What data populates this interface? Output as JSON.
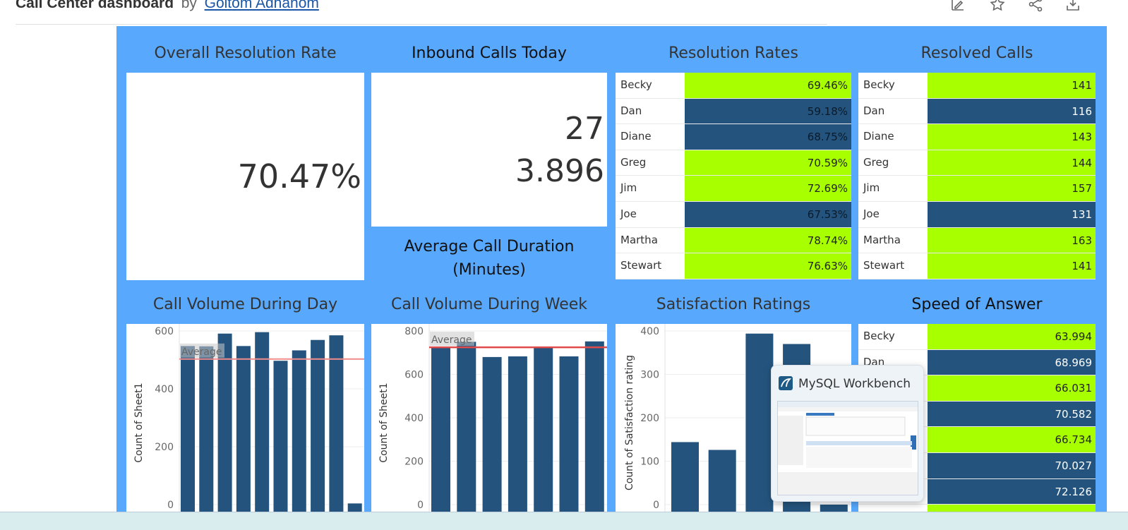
{
  "header": {
    "title": "Call Center dashboard",
    "by": "by",
    "author": "Goitom Adhanom",
    "tools": [
      "edit-icon",
      "star-icon",
      "share-icon",
      "download-icon"
    ]
  },
  "panels": {
    "overall_resolution": {
      "title": "Overall Resolution Rate",
      "value": "70.47%"
    },
    "inbound_calls": {
      "title": "Inbound Calls Today",
      "value": "27",
      "avg_value": "3.896"
    },
    "avg_duration": {
      "title_line1": "Average Call Duration",
      "title_line2": "(Minutes)"
    },
    "resolution_rates": {
      "title": "Resolution Rates",
      "rows": [
        {
          "name": "Becky",
          "value": "69.46%",
          "color": "green"
        },
        {
          "name": "Dan",
          "value": "59.18%",
          "color": "blue"
        },
        {
          "name": "Diane",
          "value": "68.75%",
          "color": "blue"
        },
        {
          "name": "Greg",
          "value": "70.59%",
          "color": "green"
        },
        {
          "name": "Jim",
          "value": "72.69%",
          "color": "green"
        },
        {
          "name": "Joe",
          "value": "67.53%",
          "color": "blue"
        },
        {
          "name": "Martha",
          "value": "78.74%",
          "color": "green"
        },
        {
          "name": "Stewart",
          "value": "76.63%",
          "color": "green"
        }
      ]
    },
    "resolved_calls": {
      "title": "Resolved Calls",
      "rows": [
        {
          "name": "Becky",
          "value": "141",
          "color": "green"
        },
        {
          "name": "Dan",
          "value": "116",
          "color": "blue"
        },
        {
          "name": "Diane",
          "value": "143",
          "color": "green"
        },
        {
          "name": "Greg",
          "value": "144",
          "color": "green"
        },
        {
          "name": "Jim",
          "value": "157",
          "color": "green"
        },
        {
          "name": "Joe",
          "value": "131",
          "color": "blue"
        },
        {
          "name": "Martha",
          "value": "163",
          "color": "green"
        },
        {
          "name": "Stewart",
          "value": "141",
          "color": "green"
        }
      ]
    },
    "speed_of_answer": {
      "title": "Speed of Answer",
      "rows": [
        {
          "name": "Becky",
          "value": "63.994",
          "color": "green"
        },
        {
          "name": "Dan",
          "value": "68.969",
          "color": "blue"
        },
        {
          "name": "",
          "value": "66.031",
          "color": "green"
        },
        {
          "name": "",
          "value": "70.582",
          "color": "blue"
        },
        {
          "name": "",
          "value": "66.734",
          "color": "green"
        },
        {
          "name": "",
          "value": "70.027",
          "color": "blue"
        },
        {
          "name": "",
          "value": "72.126",
          "color": "blue"
        },
        {
          "name": "",
          "value": "",
          "color": "green"
        }
      ]
    }
  },
  "colors": {
    "green": "#a8ff00",
    "blue": "#24547d",
    "background": "#58a9fd",
    "avg_line": "#e05a5a"
  },
  "popup": {
    "title": "MySQL Workbench"
  },
  "chart_data": [
    {
      "type": "bar",
      "title": "Call Volume During Day",
      "ylabel": "Count of Sheet1",
      "ylim": [
        0,
        600
      ],
      "yticks": [
        "0",
        "200",
        "400",
        "600"
      ],
      "average_label": "Average",
      "average": 503,
      "values": [
        548,
        547,
        591,
        548,
        596,
        497,
        533,
        569,
        585,
        4
      ]
    },
    {
      "type": "bar",
      "title": "Call Volume During Week",
      "ylabel": "Count of Sheet1",
      "ylim": [
        0,
        800
      ],
      "yticks": [
        "0",
        "200",
        "400",
        "600",
        "800"
      ],
      "average_label": "Average",
      "average": 725,
      "values": [
        727,
        750,
        680,
        683,
        722,
        683,
        752
      ]
    },
    {
      "type": "bar",
      "title": "Satisfaction Ratings",
      "ylabel": "Count of Satisfaction rating",
      "ylim": [
        0,
        400
      ],
      "yticks": [
        "0",
        "100",
        "200",
        "300",
        "400"
      ],
      "values": [
        144,
        126,
        394,
        370,
        0
      ]
    }
  ]
}
